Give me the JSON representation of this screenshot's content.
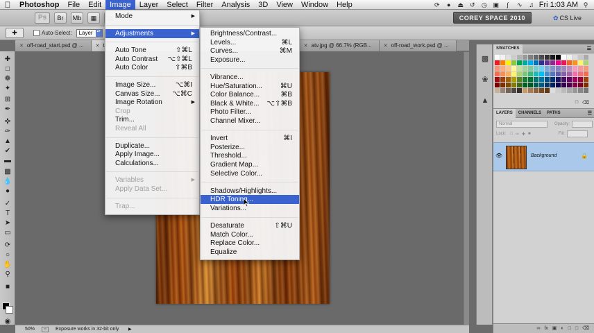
{
  "menubar": {
    "apple": "",
    "items": [
      "Photoshop",
      "File",
      "Edit",
      "Image",
      "Layer",
      "Select",
      "Filter",
      "Analysis",
      "3D",
      "View",
      "Window",
      "Help"
    ],
    "active_item": "Image",
    "status_icons": [
      "sync-icon",
      "paw-icon",
      "eject-icon",
      "time-machine-icon",
      "clock-icon",
      "display-icon",
      "bluetooth-icon",
      "wifi-icon",
      "volume-icon"
    ],
    "clock": "Fri 1:03 AM",
    "search_icon": "spotlight-icon"
  },
  "appbar": {
    "logo": "Ps",
    "workspace": "COREY SPACE 2010",
    "cs_live": "CS Live"
  },
  "options": {
    "auto_select_label": "Auto-Select:",
    "auto_select_value": "Layer"
  },
  "tabs": [
    {
      "label": "off-road_start.psd @ ...",
      "active": false
    },
    {
      "label": "te",
      "active": false
    },
    {
      "label": "atv.jpg @ 66.7% (RGB...",
      "active": false
    },
    {
      "label": "off-road_work.psd @ ...",
      "active": false
    }
  ],
  "status": {
    "zoom": "50%",
    "message": "Exposure works in 32-bit only"
  },
  "panels": {
    "swatches_title": "SWATCHES",
    "layers_tab": "LAYERS",
    "channels_tab": "CHANNELS",
    "paths_tab": "PATHS",
    "blend_mode": "Normal",
    "opacity_label": "Opacity:",
    "lock_label": "Lock:",
    "fill_label": "Fill:",
    "layer_name": "Background"
  },
  "image_menu": [
    {
      "label": "Mode",
      "submenu": true
    },
    {
      "sep": true
    },
    {
      "label": "Adjustments",
      "submenu": true,
      "highlight": true
    },
    {
      "sep": true
    },
    {
      "label": "Auto Tone",
      "shortcut": "⇧⌘L"
    },
    {
      "label": "Auto Contrast",
      "shortcut": "⌥⇧⌘L"
    },
    {
      "label": "Auto Color",
      "shortcut": "⇧⌘B"
    },
    {
      "sep": true
    },
    {
      "label": "Image Size...",
      "shortcut": "⌥⌘I"
    },
    {
      "label": "Canvas Size...",
      "shortcut": "⌥⌘C"
    },
    {
      "label": "Image Rotation",
      "submenu": true
    },
    {
      "label": "Crop",
      "disabled": true
    },
    {
      "label": "Trim..."
    },
    {
      "label": "Reveal All",
      "disabled": true
    },
    {
      "sep": true
    },
    {
      "label": "Duplicate..."
    },
    {
      "label": "Apply Image..."
    },
    {
      "label": "Calculations..."
    },
    {
      "sep": true
    },
    {
      "label": "Variables",
      "submenu": true,
      "disabled": true
    },
    {
      "label": "Apply Data Set...",
      "disabled": true
    },
    {
      "sep": true
    },
    {
      "label": "Trap...",
      "disabled": true
    }
  ],
  "adjustments_menu": [
    {
      "label": "Brightness/Contrast..."
    },
    {
      "label": "Levels...",
      "shortcut": "⌘L"
    },
    {
      "label": "Curves...",
      "shortcut": "⌘M"
    },
    {
      "label": "Exposure..."
    },
    {
      "sep": true
    },
    {
      "label": "Vibrance..."
    },
    {
      "label": "Hue/Saturation...",
      "shortcut": "⌘U"
    },
    {
      "label": "Color Balance...",
      "shortcut": "⌘B"
    },
    {
      "label": "Black & White...",
      "shortcut": "⌥⇧⌘B"
    },
    {
      "label": "Photo Filter..."
    },
    {
      "label": "Channel Mixer..."
    },
    {
      "sep": true
    },
    {
      "label": "Invert",
      "shortcut": "⌘I"
    },
    {
      "label": "Posterize..."
    },
    {
      "label": "Threshold..."
    },
    {
      "label": "Gradient Map..."
    },
    {
      "label": "Selective Color..."
    },
    {
      "sep": true
    },
    {
      "label": "Shadows/Highlights..."
    },
    {
      "label": "HDR Toning...",
      "highlight": true
    },
    {
      "label": "Variations..."
    },
    {
      "sep": true
    },
    {
      "label": "Desaturate",
      "shortcut": "⇧⌘U"
    },
    {
      "label": "Match Color..."
    },
    {
      "label": "Replace Color..."
    },
    {
      "label": "Equalize"
    }
  ],
  "swatch_colors": [
    "#ffffff",
    "#f2f2f2",
    "#e0e0e0",
    "#cccccc",
    "#b3b3b3",
    "#999999",
    "#808080",
    "#666666",
    "#4d4d4d",
    "#333333",
    "#1a1a1a",
    "#000000",
    "#ffffff",
    "#f0f0f0",
    "#dddddd",
    "#c8c8c8",
    "#aaaaaa",
    "#ed1c24",
    "#ff7f00",
    "#fff200",
    "#8dc63f",
    "#00a651",
    "#00a99d",
    "#00aeef",
    "#0072bc",
    "#2e3192",
    "#662d91",
    "#92278f",
    "#ec008c",
    "#ed145b",
    "#f26522",
    "#f7941d",
    "#fff568",
    "#acd373",
    "#f69679",
    "#f9ad81",
    "#fdc68a",
    "#fff799",
    "#c4df9b",
    "#a3d39c",
    "#82ca9d",
    "#7accc8",
    "#6dcff6",
    "#7da7d9",
    "#8393ca",
    "#8781bd",
    "#a187be",
    "#bd8cbf",
    "#f49ac2",
    "#f5989d",
    "#f7977a",
    "#f26c4f",
    "#f68e55",
    "#fbaf5c",
    "#fff467",
    "#acd372",
    "#7cc576",
    "#3bb878",
    "#1abbb4",
    "#00bff3",
    "#438ccb",
    "#5574b9",
    "#605ca8",
    "#855fa8",
    "#a763a8",
    "#f06ea9",
    "#f26d7d",
    "#f16c4f",
    "#9e0b0f",
    "#a0410d",
    "#a36209",
    "#aba000",
    "#598527",
    "#1a7b30",
    "#007236",
    "#00746b",
    "#0076a3",
    "#004b80",
    "#003471",
    "#1b1464",
    "#440e62",
    "#630460",
    "#9e005d",
    "#9e0039",
    "#a0410d",
    "#790000",
    "#7b2e00",
    "#7d4900",
    "#827b00",
    "#406618",
    "#005e20",
    "#005826",
    "#005952",
    "#005b7f",
    "#003663",
    "#002157",
    "#0d004c",
    "#32004b",
    "#4b0049",
    "#7b0046",
    "#7a0026",
    "#7b2e00",
    "#c7b299",
    "#998675",
    "#736357",
    "#534741",
    "#37302d",
    "#c69c6d",
    "#a67c52",
    "#8c6239",
    "#754c24",
    "#603913",
    "#dddddd",
    "#cccccc",
    "#bbbbbb",
    "#aaaaaa",
    "#999999",
    "#888888",
    "#777777"
  ]
}
